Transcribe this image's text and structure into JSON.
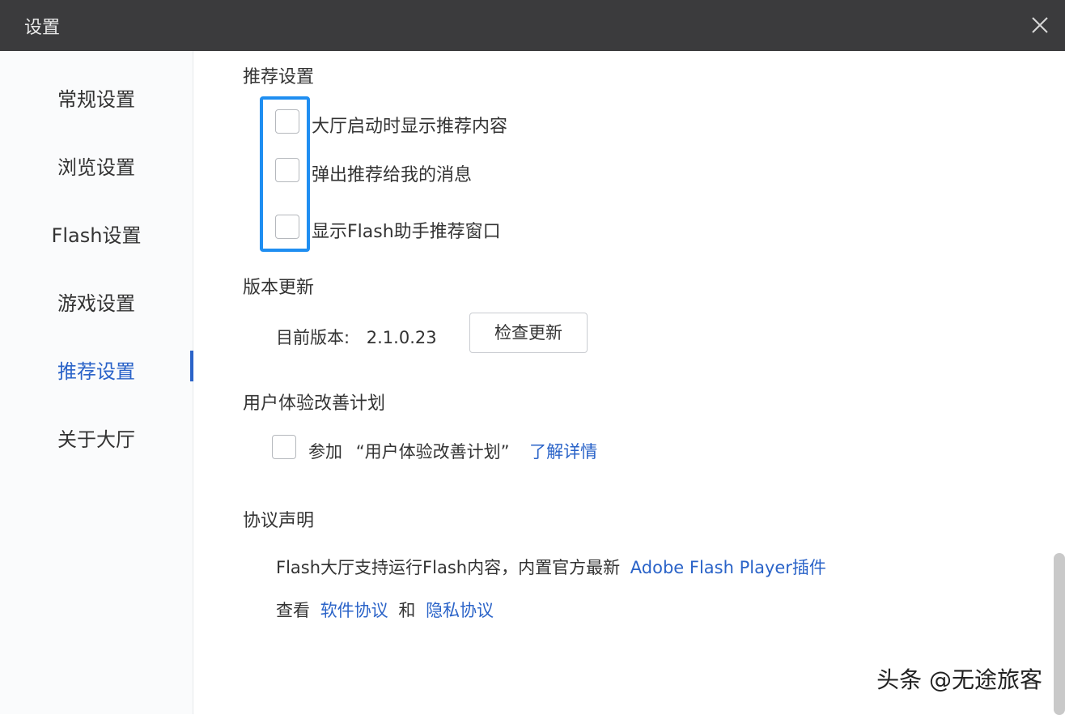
{
  "window": {
    "title": "设置"
  },
  "sidebar": {
    "items": [
      {
        "label": "常规设置"
      },
      {
        "label": "浏览设置"
      },
      {
        "label": "Flash设置"
      },
      {
        "label": "游戏设置"
      },
      {
        "label": "推荐设置",
        "active": true
      },
      {
        "label": "关于大厅"
      }
    ]
  },
  "recommend": {
    "title": "推荐设置",
    "options": [
      {
        "label": "大厅启动时显示推荐内容",
        "checked": false
      },
      {
        "label": "弹出推荐给我的消息",
        "checked": false
      },
      {
        "label": "显示Flash助手推荐窗口",
        "checked": false
      }
    ]
  },
  "update": {
    "title": "版本更新",
    "current_label": "目前版本:",
    "version": "2.1.0.23",
    "check_button": "检查更新"
  },
  "ux": {
    "title": "用户体验改善计划",
    "join_label": "参加",
    "program_name": "“用户体验改善计划”",
    "details_link": "了解详情",
    "checked": false
  },
  "agreement": {
    "title": "协议声明",
    "line1_text": "Flash大厅支持运行Flash内容，内置官方最新",
    "line1_link": "Adobe Flash Player插件",
    "line2_prefix": "查看",
    "software_link": "软件协议",
    "and": "和",
    "privacy_link": "隐私协议"
  },
  "watermark": "头条 @无途旅客",
  "colors": {
    "accent": "#2a63c8",
    "highlight": "#1f8ef1",
    "titlebar": "#3b3b3d"
  }
}
